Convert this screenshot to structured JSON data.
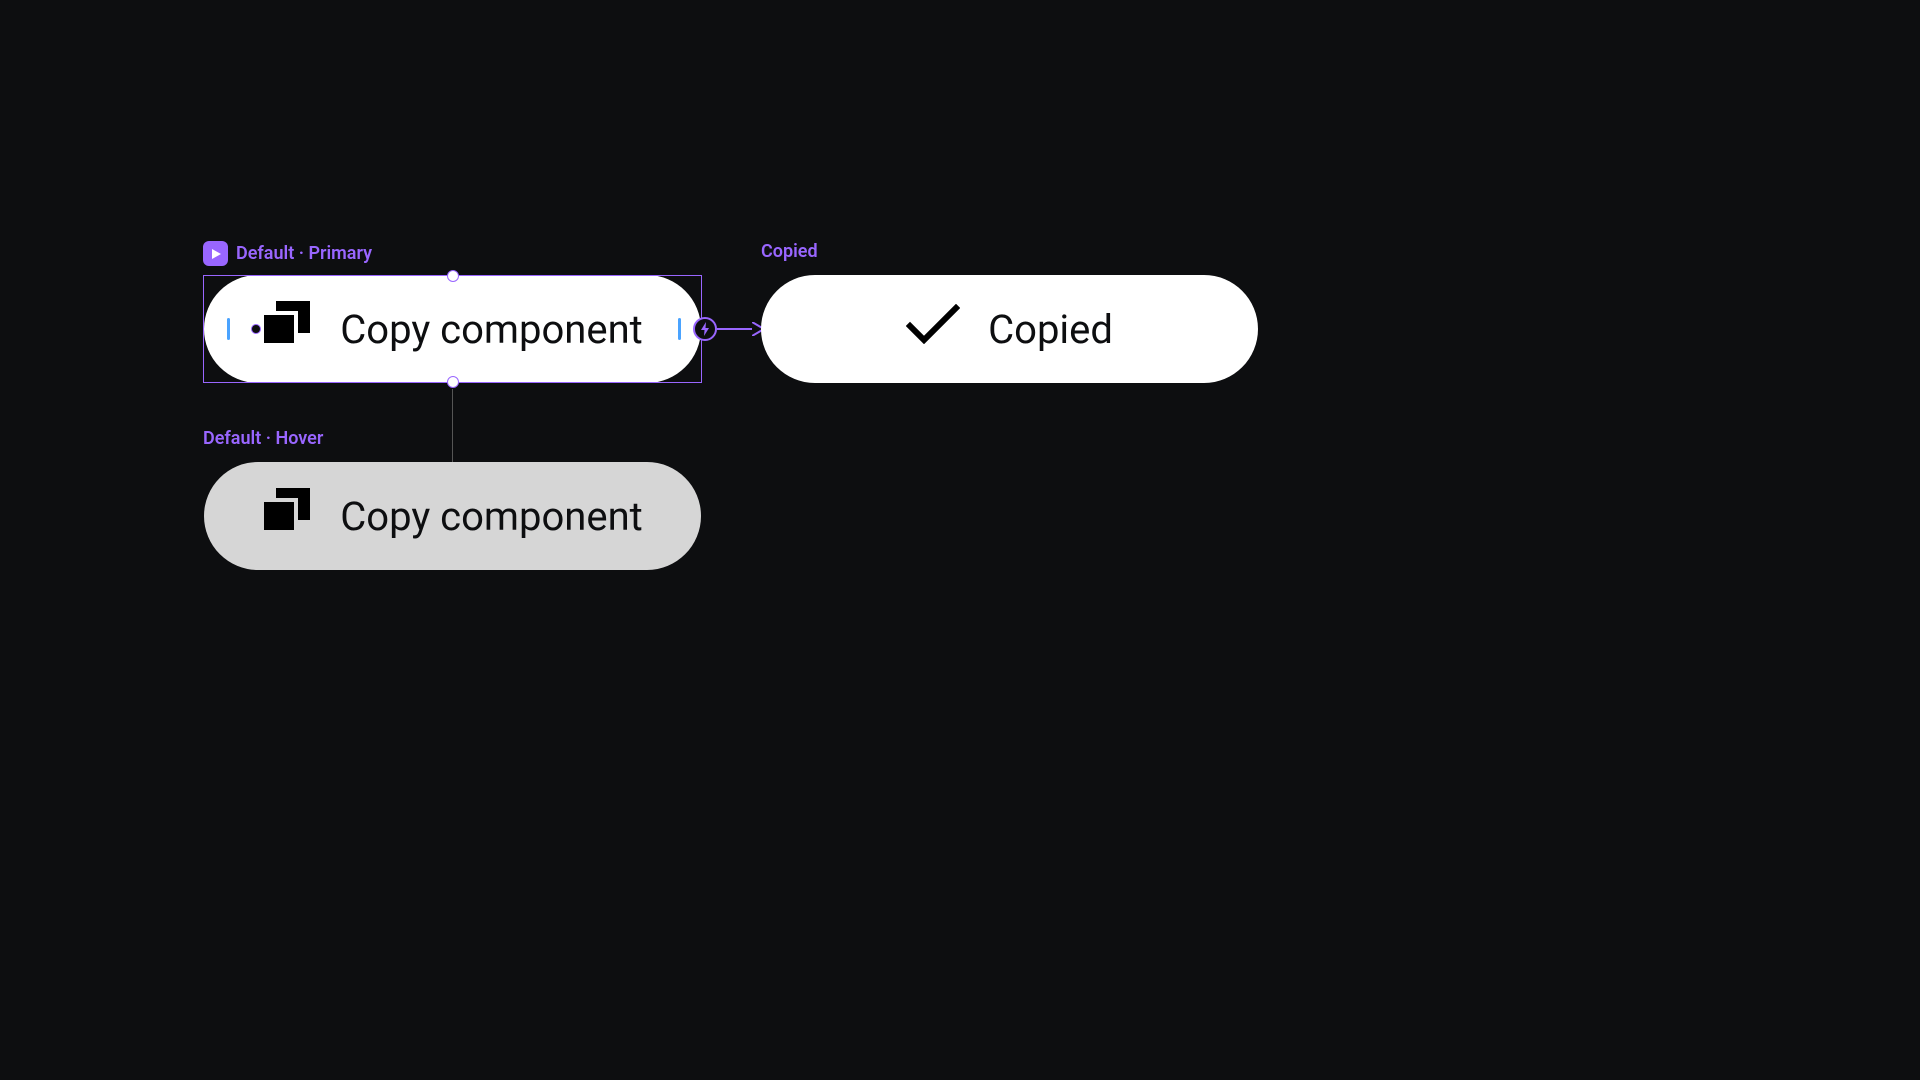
{
  "colors": {
    "accent": "#9966ff",
    "bg": "#0d0e10",
    "pill": "#ffffff",
    "pillHover": "#d6d6d6",
    "padHandle": "#4aa3ff"
  },
  "variants": {
    "primary": {
      "label": "Default · Primary",
      "button_text": "Copy component",
      "icon": "copy-icon"
    },
    "hover": {
      "label": "Default · Hover",
      "button_text": "Copy component",
      "icon": "copy-icon"
    },
    "copied": {
      "label": "Copied",
      "button_text": "Copied",
      "icon": "check-icon"
    }
  }
}
